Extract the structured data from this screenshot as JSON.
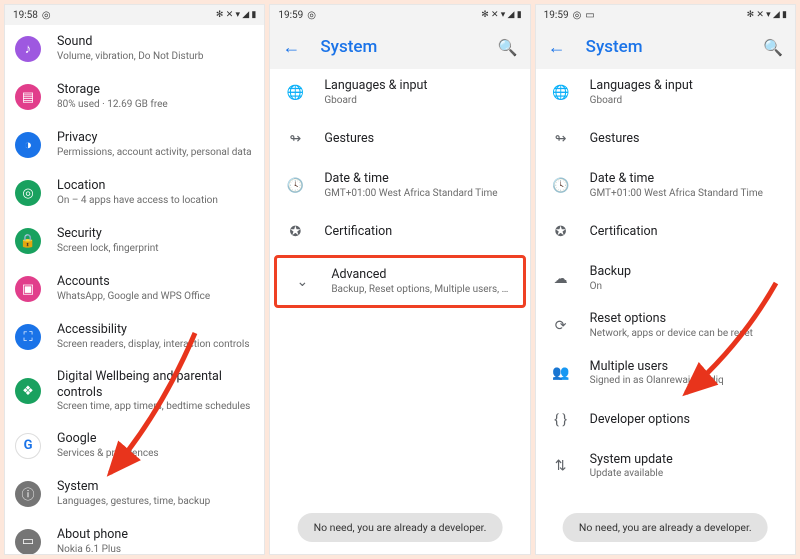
{
  "panel1": {
    "time": "19:58",
    "status_icons": "✻ ✕ ▾ ◢ ▮",
    "items": [
      {
        "icon": "♪",
        "color": "#9e58e0",
        "title": "Sound",
        "sub": "Volume, vibration, Do Not Disturb"
      },
      {
        "icon": "▤",
        "color": "#e13e8b",
        "title": "Storage",
        "sub": "80% used · 12.69 GB free"
      },
      {
        "icon": "◑",
        "color": "#1a73e8",
        "title": "Privacy",
        "sub": "Permissions, account activity, personal data"
      },
      {
        "icon": "◎",
        "color": "#19a15f",
        "title": "Location",
        "sub": "On – 4 apps have access to location"
      },
      {
        "icon": "🔒",
        "color": "#19a15f",
        "title": "Security",
        "sub": "Screen lock, fingerprint"
      },
      {
        "icon": "▣",
        "color": "#e13e8b",
        "title": "Accounts",
        "sub": "WhatsApp, Google and WPS Office"
      },
      {
        "icon": "⛶",
        "color": "#1a73e8",
        "title": "Accessibility",
        "sub": "Screen readers, display, interaction controls"
      },
      {
        "icon": "❖",
        "color": "#19a15f",
        "title": "Digital Wellbeing and parental controls",
        "sub": "Screen time, app timers, bedtime schedules"
      },
      {
        "icon": "G",
        "color": "#1a73e8",
        "title": "Google",
        "sub": "Services & preferences"
      },
      {
        "icon": "ⓘ",
        "color": "#757575",
        "title": "System",
        "sub": "Languages, gestures, time, backup"
      },
      {
        "icon": "▭",
        "color": "#757575",
        "title": "About phone",
        "sub": "Nokia 6.1 Plus"
      }
    ]
  },
  "panel2": {
    "time": "19:59",
    "status_icons": "✻ ✕ ▾ ◢ ▮",
    "header": "System",
    "toast": "No need, you are already a developer.",
    "items": [
      {
        "icon": "🌐",
        "title": "Languages & input",
        "sub": "Gboard"
      },
      {
        "icon": "↬",
        "title": "Gestures",
        "sub": ""
      },
      {
        "icon": "🕓",
        "title": "Date & time",
        "sub": "GMT+01:00 West Africa Standard Time"
      },
      {
        "icon": "✪",
        "title": "Certification",
        "sub": ""
      }
    ],
    "advanced": {
      "icon": "⌄",
      "title": "Advanced",
      "sub": "Backup, Reset options, Multiple users, Developer o…"
    }
  },
  "panel3": {
    "time": "19:59",
    "status_icons": "✻ ✕ ▾ ◢ ▮",
    "header": "System",
    "toast": "No need, you are already a developer.",
    "items": [
      {
        "icon": "🌐",
        "title": "Languages & input",
        "sub": "Gboard"
      },
      {
        "icon": "↬",
        "title": "Gestures",
        "sub": ""
      },
      {
        "icon": "🕓",
        "title": "Date & time",
        "sub": "GMT+01:00 West Africa Standard Time"
      },
      {
        "icon": "✪",
        "title": "Certification",
        "sub": ""
      },
      {
        "icon": "☁",
        "title": "Backup",
        "sub": "On"
      },
      {
        "icon": "⟳",
        "title": "Reset options",
        "sub": "Network, apps or device can be reset"
      },
      {
        "icon": "👥",
        "title": "Multiple users",
        "sub": "Signed in as Olanrewaju Sodiq"
      },
      {
        "icon": "{ }",
        "title": "Developer options",
        "sub": ""
      },
      {
        "icon": "⇅",
        "title": "System update",
        "sub": "Update available"
      }
    ]
  }
}
